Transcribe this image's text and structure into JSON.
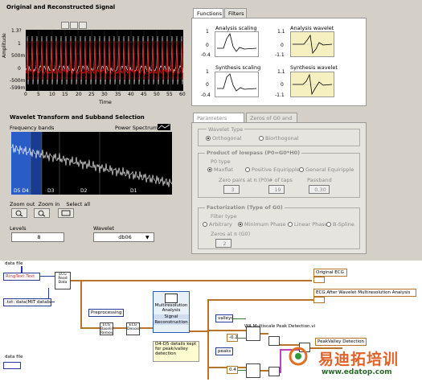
{
  "signal_panel": {
    "title": "Original and Reconstructed Signal",
    "ylabel": "Amplitude",
    "xlabel": "Time",
    "yticks": [
      "1.3?",
      "1",
      "500m",
      "0",
      "-500m",
      "-599m"
    ],
    "xticks": [
      "0",
      "5",
      "10",
      "15",
      "20",
      "25",
      "30",
      "35",
      "40",
      "45",
      "50",
      "55",
      "60"
    ]
  },
  "wavelet_panel": {
    "title": "Wavelet Transform and Subband Selection",
    "freq_label": "Frequency bands",
    "power_label": "Power Spectrum",
    "bands": [
      "D5 D4",
      "D3",
      "D2",
      "D1"
    ],
    "zoom_out_label": "Zoom out",
    "zoom_in_label": "Zoom in",
    "select_all_label": "Select all",
    "levels_label": "Levels",
    "levels_value": "8",
    "wavelet_label": "Wavelet",
    "wavelet_value": "db06"
  },
  "functions_tabs": {
    "tab1": "Functions",
    "tab2": "Filters",
    "analysis_scaling": "Analysis scaling",
    "analysis_wavelet": "Analysis wavelet",
    "synthesis_scaling": "Synthesis scaling",
    "synthesis_wavelet": "Synthesis wavelet",
    "scaling_ticks": [
      "1",
      "0",
      "-0.4"
    ],
    "wavelet_ticks": [
      "1.1",
      "0",
      "-1.1"
    ]
  },
  "params": {
    "tab1": "Parameters Settings",
    "tab2": "Zeros of G0 and H0",
    "wavelet_type_label": "Wavelet Type",
    "orthogonal": "Orthogonal",
    "biorthogonal": "Biorthogonal",
    "product_label": "Product of lowpass (P0=G0*H0)",
    "p0_type_label": "P0 type",
    "maxflat": "Maxflat",
    "positive_equiripple": "Positive Equiripple",
    "general_equiripple": "General Equiripple",
    "zero_pairs_label": "Zero pairs at π (P0)",
    "taps_label": "# of taps",
    "passband_label": "Passband",
    "zero_pairs_value": "3",
    "taps_value": "19",
    "passband_value": "0.30",
    "factorization_label": "Factorization (Type of G0)",
    "filter_type_label": "Filter type",
    "arbitrary": "Arbitrary",
    "minimum_phase": "Minimum Phase",
    "linear_phase": "Linear Phase",
    "bspline": "B-Spline",
    "zeros_g0_label": "Zeros at π (G0)",
    "zeros_g0_value": "2"
  },
  "diagram": {
    "data_file_label": "data file",
    "ring_text": "RingText.Text",
    "read_data_node": "ECG Read Data",
    "txt_label": ".txt: data(MIT database)",
    "preprocessing_label": "Preprocessing",
    "baseline_node": "ECG Baseline Removal",
    "denoise_node": "ECG Denoise",
    "mra_title": "Multiresolution Analysis",
    "mra_signal": "Signal",
    "mra_recon": "Reconstruction",
    "comment": "D4-D5 details kept for peak/valley detection",
    "original_ecg": "Original ECG",
    "ecg_after": "ECG After Wavelet Multiresolution Analysis",
    "valleys": "valleys",
    "peaks": "peaks",
    "minus_02": "-0.2",
    "plus_04": "0.4",
    "multiscale_vi": "WA Multiscale Peak Detection.vi",
    "peak_valley": "PeakValley Detection",
    "data_file_2": "data file"
  },
  "watermark": {
    "cn_text": "易迪拓培训",
    "url": "www.edatop.com"
  }
}
